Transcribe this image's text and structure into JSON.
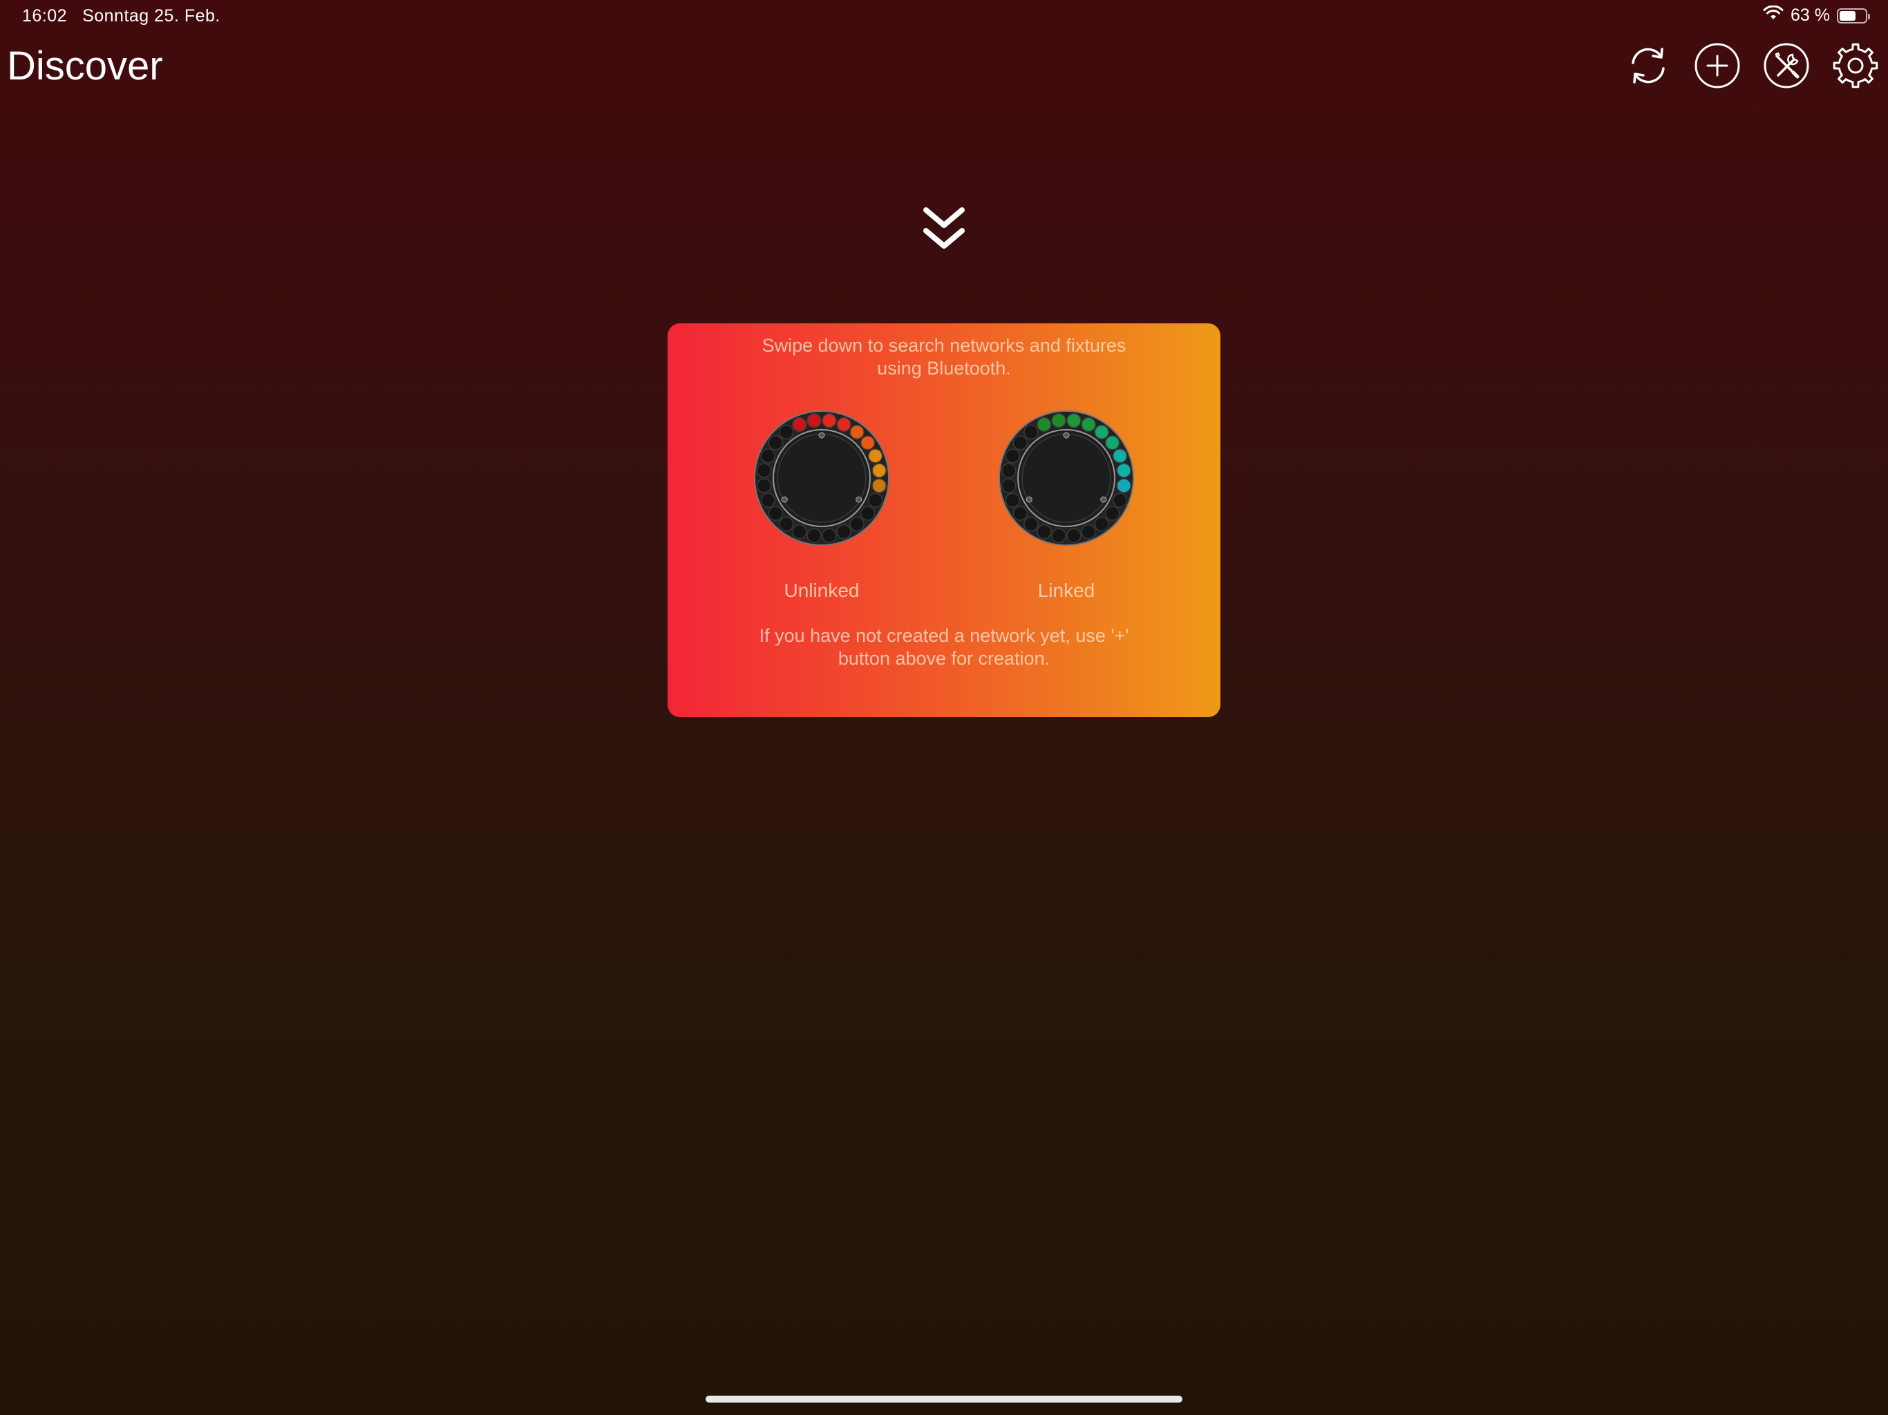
{
  "status": {
    "time": "16:02",
    "date": "Sonntag 25. Feb.",
    "battery_text": "63 %",
    "battery_level": 0.63
  },
  "header": {
    "title": "Discover"
  },
  "toolbar": {
    "icons": [
      "refresh-icon",
      "plus-circle-icon",
      "tools-icon",
      "gear-icon"
    ]
  },
  "card": {
    "top_text_line1": "Swipe down to search networks and fixtures",
    "top_text_line2": "using Bluetooth.",
    "unlinked_label": "Unlinked",
    "linked_label": "Linked",
    "bottom_text_line1": "If you have not created a network yet, use '+'",
    "bottom_text_line2": "button above for creation."
  },
  "colors": {
    "card_gradient_start": "#f22636",
    "card_gradient_end": "#ef9a17",
    "unlinked_leds": [
      "#c8141a",
      "#e02a1a",
      "#e85a14",
      "#e08a10",
      "#c8780c"
    ],
    "linked_leds": [
      "#1f8a2a",
      "#1a9a3a",
      "#14a86a",
      "#10b0a8",
      "#12a8b8"
    ]
  }
}
